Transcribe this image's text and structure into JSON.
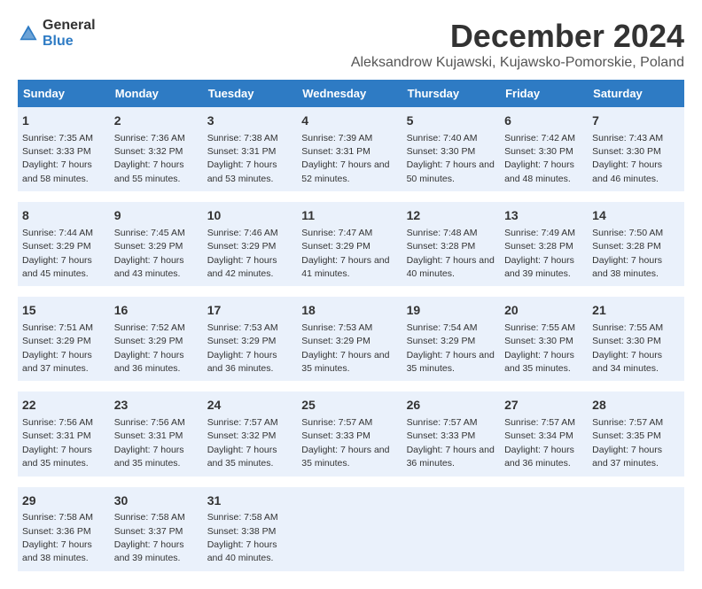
{
  "logo": {
    "general": "General",
    "blue": "Blue"
  },
  "title": "December 2024",
  "subtitle": "Aleksandrow Kujawski, Kujawsko-Pomorskie, Poland",
  "columns": [
    "Sunday",
    "Monday",
    "Tuesday",
    "Wednesday",
    "Thursday",
    "Friday",
    "Saturday"
  ],
  "weeks": [
    [
      {
        "day": "1",
        "sunrise": "7:35 AM",
        "sunset": "3:33 PM",
        "daylight": "7 hours and 58 minutes."
      },
      {
        "day": "2",
        "sunrise": "7:36 AM",
        "sunset": "3:32 PM",
        "daylight": "7 hours and 55 minutes."
      },
      {
        "day": "3",
        "sunrise": "7:38 AM",
        "sunset": "3:31 PM",
        "daylight": "7 hours and 53 minutes."
      },
      {
        "day": "4",
        "sunrise": "7:39 AM",
        "sunset": "3:31 PM",
        "daylight": "7 hours and 52 minutes."
      },
      {
        "day": "5",
        "sunrise": "7:40 AM",
        "sunset": "3:30 PM",
        "daylight": "7 hours and 50 minutes."
      },
      {
        "day": "6",
        "sunrise": "7:42 AM",
        "sunset": "3:30 PM",
        "daylight": "7 hours and 48 minutes."
      },
      {
        "day": "7",
        "sunrise": "7:43 AM",
        "sunset": "3:30 PM",
        "daylight": "7 hours and 46 minutes."
      }
    ],
    [
      {
        "day": "8",
        "sunrise": "7:44 AM",
        "sunset": "3:29 PM",
        "daylight": "7 hours and 45 minutes."
      },
      {
        "day": "9",
        "sunrise": "7:45 AM",
        "sunset": "3:29 PM",
        "daylight": "7 hours and 43 minutes."
      },
      {
        "day": "10",
        "sunrise": "7:46 AM",
        "sunset": "3:29 PM",
        "daylight": "7 hours and 42 minutes."
      },
      {
        "day": "11",
        "sunrise": "7:47 AM",
        "sunset": "3:29 PM",
        "daylight": "7 hours and 41 minutes."
      },
      {
        "day": "12",
        "sunrise": "7:48 AM",
        "sunset": "3:28 PM",
        "daylight": "7 hours and 40 minutes."
      },
      {
        "day": "13",
        "sunrise": "7:49 AM",
        "sunset": "3:28 PM",
        "daylight": "7 hours and 39 minutes."
      },
      {
        "day": "14",
        "sunrise": "7:50 AM",
        "sunset": "3:28 PM",
        "daylight": "7 hours and 38 minutes."
      }
    ],
    [
      {
        "day": "15",
        "sunrise": "7:51 AM",
        "sunset": "3:29 PM",
        "daylight": "7 hours and 37 minutes."
      },
      {
        "day": "16",
        "sunrise": "7:52 AM",
        "sunset": "3:29 PM",
        "daylight": "7 hours and 36 minutes."
      },
      {
        "day": "17",
        "sunrise": "7:53 AM",
        "sunset": "3:29 PM",
        "daylight": "7 hours and 36 minutes."
      },
      {
        "day": "18",
        "sunrise": "7:53 AM",
        "sunset": "3:29 PM",
        "daylight": "7 hours and 35 minutes."
      },
      {
        "day": "19",
        "sunrise": "7:54 AM",
        "sunset": "3:29 PM",
        "daylight": "7 hours and 35 minutes."
      },
      {
        "day": "20",
        "sunrise": "7:55 AM",
        "sunset": "3:30 PM",
        "daylight": "7 hours and 35 minutes."
      },
      {
        "day": "21",
        "sunrise": "7:55 AM",
        "sunset": "3:30 PM",
        "daylight": "7 hours and 34 minutes."
      }
    ],
    [
      {
        "day": "22",
        "sunrise": "7:56 AM",
        "sunset": "3:31 PM",
        "daylight": "7 hours and 35 minutes."
      },
      {
        "day": "23",
        "sunrise": "7:56 AM",
        "sunset": "3:31 PM",
        "daylight": "7 hours and 35 minutes."
      },
      {
        "day": "24",
        "sunrise": "7:57 AM",
        "sunset": "3:32 PM",
        "daylight": "7 hours and 35 minutes."
      },
      {
        "day": "25",
        "sunrise": "7:57 AM",
        "sunset": "3:33 PM",
        "daylight": "7 hours and 35 minutes."
      },
      {
        "day": "26",
        "sunrise": "7:57 AM",
        "sunset": "3:33 PM",
        "daylight": "7 hours and 36 minutes."
      },
      {
        "day": "27",
        "sunrise": "7:57 AM",
        "sunset": "3:34 PM",
        "daylight": "7 hours and 36 minutes."
      },
      {
        "day": "28",
        "sunrise": "7:57 AM",
        "sunset": "3:35 PM",
        "daylight": "7 hours and 37 minutes."
      }
    ],
    [
      {
        "day": "29",
        "sunrise": "7:58 AM",
        "sunset": "3:36 PM",
        "daylight": "7 hours and 38 minutes."
      },
      {
        "day": "30",
        "sunrise": "7:58 AM",
        "sunset": "3:37 PM",
        "daylight": "7 hours and 39 minutes."
      },
      {
        "day": "31",
        "sunrise": "7:58 AM",
        "sunset": "3:38 PM",
        "daylight": "7 hours and 40 minutes."
      },
      null,
      null,
      null,
      null
    ]
  ]
}
